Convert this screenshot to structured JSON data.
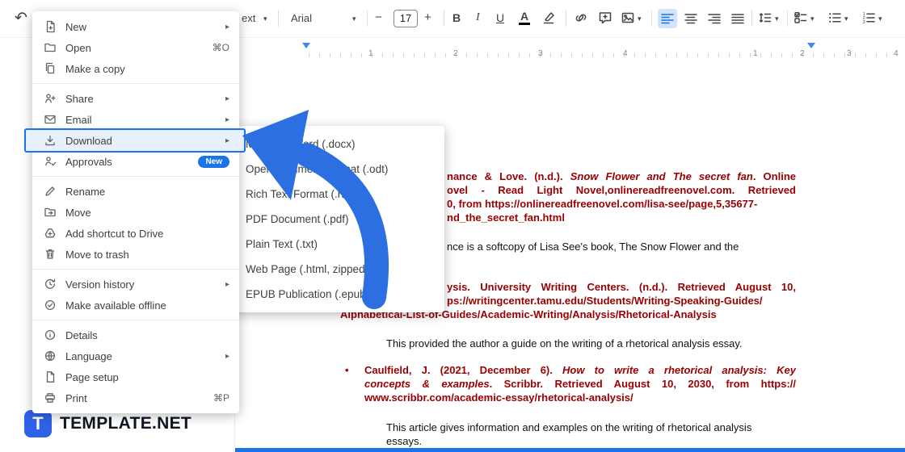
{
  "icons": {
    "undo": "↶",
    "dropdown": "▾",
    "submenu_arrow": "▸",
    "minus": "−",
    "plus": "+",
    "bullet": "•"
  },
  "toolbar": {
    "style_partial": "ext",
    "font_name": "Arial",
    "font_size": "17",
    "bold": "B",
    "italic": "I",
    "underline": "U",
    "text_color": "A"
  },
  "ruler": {
    "left_numbers": [
      "1",
      "2",
      "3",
      "4"
    ],
    "right_numbers": [
      "1",
      "2",
      "3",
      "4"
    ]
  },
  "file_menu": {
    "items": [
      {
        "label": "New"
      },
      {
        "label": "Open",
        "shortcut": "⌘O"
      },
      {
        "label": "Make a copy"
      },
      {
        "label": "Share"
      },
      {
        "label": "Email"
      },
      {
        "label": "Download"
      },
      {
        "label": "Approvals",
        "badge": "New"
      },
      {
        "label": "Rename"
      },
      {
        "label": "Move"
      },
      {
        "label": "Add shortcut to Drive"
      },
      {
        "label": "Move to trash"
      },
      {
        "label": "Version history"
      },
      {
        "label": "Make available offline"
      },
      {
        "label": "Details"
      },
      {
        "label": "Language"
      },
      {
        "label": "Page setup"
      },
      {
        "label": "Print",
        "shortcut": "⌘P"
      }
    ]
  },
  "download_submenu": {
    "items": [
      "Microsoft Word (.docx)",
      "OpenDocument Format (.odt)",
      "Rich Text Format (.rtf)",
      "PDF Document (.pdf)",
      "Plain Text (.txt)",
      "Web Page (.html, zipped)",
      "EPUB Publication (.epub)"
    ]
  },
  "document": {
    "ref1_l1a": "nance & Love. (n.d.). ",
    "ref1_l1b": "Snow Flower and The secret fan",
    "ref1_l1c": ". Online",
    "ref1_l2": "ovel - Read Light Novel,onlinereadfreenovel.com. Retrieved",
    "ref1_l3": "0, from https://onlinereadfreenovel.com/lisa-see/page,5,35677-",
    "ref1_l4": "nd_the_secret_fan.html",
    "note1": "nce is a softcopy of Lisa See's book, The Snow Flower and the",
    "ref2_l1": "ysis. University Writing Centers. (n.d.). Retrieved August 10,",
    "ref2_l2": "ps://writingcenter.tamu.edu/Students/Writing-Speaking-Guides/",
    "ref2_l3": "Alphabetical-List-of-Guides/Academic-Writing/Analysis/Rhetorical-Analysis",
    "note2": "This provided the author a guide on the writing of a rhetorical analysis essay.",
    "ref3_l1a": "Caulfield, J. (2021, December 6). ",
    "ref3_l1b": "How to write a rhetorical analysis: Key",
    "ref3_l2a": "concepts & examples",
    "ref3_l2b": ". Scribbr. Retrieved August 10, 2030, from https://",
    "ref3_l3": "www.scribbr.com/academic-essay/rhetorical-analysis/",
    "note3_l1": "This article gives information and examples on the writing of rhetorical analysis",
    "note3_l2": "essays."
  },
  "branding": {
    "logo_letter": "T",
    "logo_text": "TEMPLATE.NET"
  }
}
